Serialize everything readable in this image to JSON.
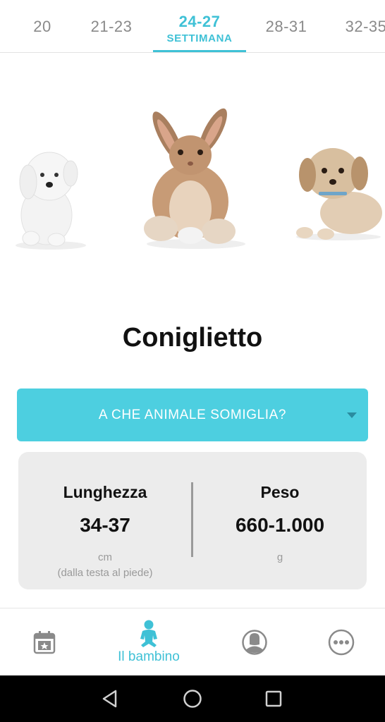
{
  "tabs": [
    {
      "label": "20"
    },
    {
      "label": "21-23"
    },
    {
      "label": "24-27",
      "sublabel": "SETTIMANA"
    },
    {
      "label": "28-31"
    },
    {
      "label": "32-35"
    }
  ],
  "active_tab_index": 2,
  "animals": [
    {
      "icon": "white-puppy-image"
    },
    {
      "icon": "bunny-image"
    },
    {
      "icon": "beige-puppy-image"
    }
  ],
  "animal_name": "Coniglietto",
  "dropdown": {
    "label": "A CHE ANIMALE SOMIGLIA?"
  },
  "stats": {
    "length": {
      "label": "Lunghezza",
      "value": "34-37",
      "unit": "cm",
      "note": "(dalla testa al piede)"
    },
    "weight": {
      "label": "Peso",
      "value": "660-1.000",
      "unit": "g"
    }
  },
  "bottom_nav": {
    "calendar": {
      "icon": "calendar-star-icon"
    },
    "baby": {
      "icon": "baby-icon",
      "label": "Il bambino"
    },
    "profile": {
      "icon": "profile-icon"
    },
    "more": {
      "icon": "more-icon"
    }
  },
  "colors": {
    "accent": "#3fc1d6",
    "dropdown_bg": "#4dcfe0",
    "card_bg": "#ececec",
    "muted": "#9a9a9a"
  }
}
